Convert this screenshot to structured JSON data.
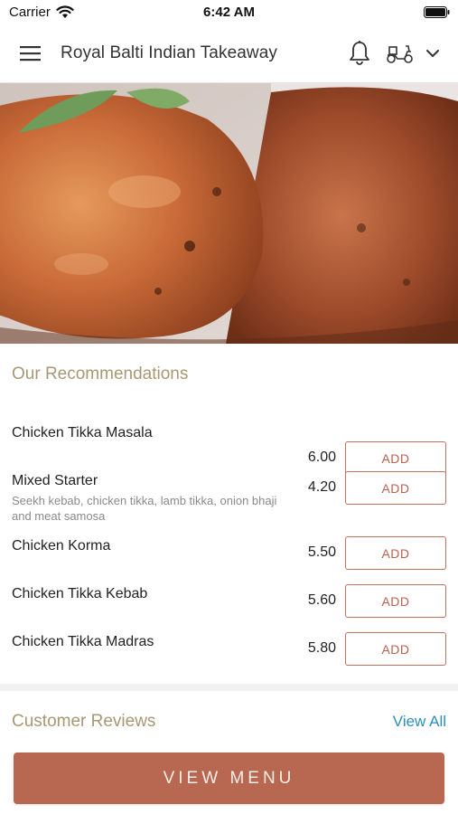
{
  "status_bar": {
    "carrier": "Carrier",
    "time": "6:42 AM"
  },
  "header": {
    "title": "Royal Balti Indian Takeaway",
    "icons": [
      "menu-icon",
      "bell-icon",
      "scooter-icon",
      "chevron-down-icon"
    ]
  },
  "hero": {
    "image": "grilled tandoori chicken with mint leaf"
  },
  "recommendations": {
    "heading": "Our Recommendations",
    "add_label": "ADD",
    "items": [
      {
        "name": "Chicken Tikka Masala",
        "description": "",
        "price": "6.00"
      },
      {
        "name": "Mixed Starter",
        "description": "Seekh kebab, chicken tikka, lamb tikka, onion bhaji and meat samosa",
        "price": "4.20"
      },
      {
        "name": "Chicken Korma",
        "description": "",
        "price": "5.50"
      },
      {
        "name": "Chicken Tikka Kebab",
        "description": "",
        "price": "5.60"
      },
      {
        "name": "Chicken Tikka Madras",
        "description": "",
        "price": "5.80"
      }
    ]
  },
  "reviews": {
    "heading": "Customer Reviews",
    "view_all": "View All"
  },
  "footer": {
    "view_menu": "VIEW MENU"
  },
  "colors": {
    "accent": "#b86850",
    "heading": "#a89874",
    "link": "#2b8fbf"
  }
}
